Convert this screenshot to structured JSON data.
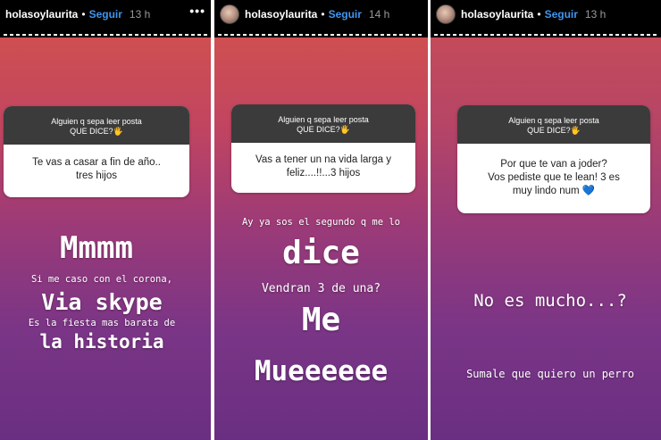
{
  "stories": [
    {
      "header": {
        "username": "holasoylaurita",
        "follow": "Seguir",
        "time": "13 h",
        "more": "•••"
      },
      "card": {
        "question_line1": "Alguien q sepa leer posta",
        "question_line2": "QUE DICE?🖐",
        "answer_line1": "Te vas a casar a fin de año..",
        "answer_line2": "tres hijos"
      },
      "texts": [
        "Mmmm",
        "Si me caso con el corona,",
        "Via skype",
        "Es la fiesta mas barata de",
        "la historia"
      ]
    },
    {
      "header": {
        "username": "holasoylaurita",
        "follow": "Seguir",
        "time": "14 h",
        "more": "•••"
      },
      "card": {
        "question_line1": "Alguien q sepa leer posta",
        "question_line2": "QUE DICE?🖐",
        "answer_line1": "Vas a tener un na vida larga y",
        "answer_line2": "feliz....!!...3 hijos"
      },
      "texts": [
        "Ay ya sos el segundo q me lo",
        "dice",
        "Vendran 3 de una?",
        "Me",
        "Mueeeeee"
      ]
    },
    {
      "header": {
        "username": "holasoylaurita",
        "follow": "Seguir",
        "time": "13 h",
        "more": "•••"
      },
      "card": {
        "question_line1": "Alguien q sepa leer posta",
        "question_line2": "QUE DICE?🖐",
        "answer_line1": "Por que te van a joder?",
        "answer_line2": "Vos pediste que te lean! 3 es",
        "answer_line3": "muy lindo num 💙"
      },
      "texts": [
        "No es mucho...?",
        "Sumale que quiero un perro"
      ]
    }
  ]
}
